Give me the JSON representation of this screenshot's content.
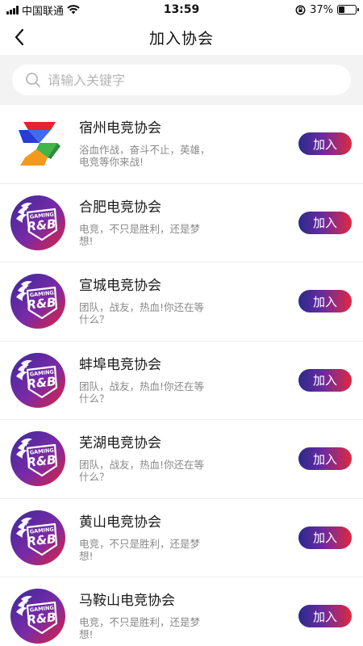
{
  "status": {
    "carrier": "中国联通",
    "time": "13:59",
    "battery": "37%",
    "battery_level": 0.37
  },
  "nav": {
    "title": "加入协会"
  },
  "search": {
    "placeholder": "请输入关键字"
  },
  "list": [
    {
      "name": "宿州电竞协会",
      "desc": "浴血作战，奋斗不止，英雄，电竞等你来战!",
      "button": "加入",
      "logo": "suzhou-colorful-s-logo"
    },
    {
      "name": "合肥电竞协会",
      "desc": "电竞，不只是胜利，还是梦想!",
      "button": "加入",
      "logo": "rb-gaming-logo"
    },
    {
      "name": "宣城电竞协会",
      "desc": "团队，战友，热血!你还在等什么？",
      "button": "加入",
      "logo": "rb-gaming-logo"
    },
    {
      "name": "蚌埠电竞协会",
      "desc": "团队，战友，热血!你还在等什么？",
      "button": "加入",
      "logo": "rb-gaming-logo"
    },
    {
      "name": "芜湖电竞协会",
      "desc": "团队，战友，热血!你还在等什么？",
      "button": "加入",
      "logo": "rb-gaming-logo"
    },
    {
      "name": "黄山电竞协会",
      "desc": "电竞，不只是胜利，还是梦想!",
      "button": "加入",
      "logo": "rb-gaming-logo"
    },
    {
      "name": "马鞍山电竞协会",
      "desc": "电竞，不只是胜利，还是梦想!",
      "button": "加入",
      "logo": "rb-gaming-logo"
    }
  ],
  "logo_text": {
    "gaming": "GAMING",
    "rb": "R&B"
  },
  "colors": {
    "button_start": "#2b2a8c",
    "button_mid": "#6a2aa0",
    "button_end": "#e0293f"
  }
}
